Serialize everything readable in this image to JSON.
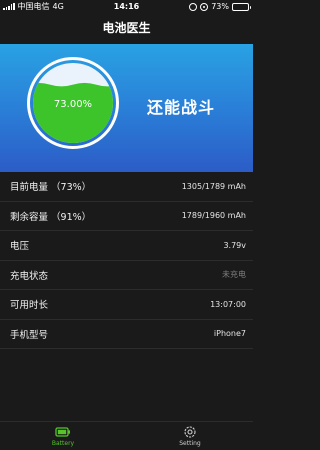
{
  "status_bar": {
    "carrier": "中国电信",
    "network": "4G",
    "time": "14:16",
    "battery_percent": "73%"
  },
  "nav": {
    "title": "电池医生"
  },
  "hero": {
    "charge_label": "73.00%",
    "charge_fraction": 0.73,
    "title": "还能战斗"
  },
  "rows": [
    {
      "label": "目前电量 （73%）",
      "value": "1305/1789 mAh"
    },
    {
      "label": "剩余容量 （91%）",
      "value": "1789/1960 mAh"
    },
    {
      "label": "电压",
      "value": "3.79v"
    },
    {
      "label": "充电状态",
      "value": "未充电"
    },
    {
      "label": "可用时长",
      "value": "13:07:00"
    },
    {
      "label": "手机型号",
      "value": "iPhone7"
    }
  ],
  "tabs": [
    {
      "label": "Battery",
      "icon": "battery-icon",
      "active": true
    },
    {
      "label": "Setting",
      "icon": "gear-icon",
      "active": false
    }
  ],
  "colors": {
    "accent": "#57c52a",
    "liquid": "#3dc42b",
    "hero_top": "#29a2e3",
    "hero_bottom": "#2c5cc7",
    "background": "#1a1a1a"
  }
}
